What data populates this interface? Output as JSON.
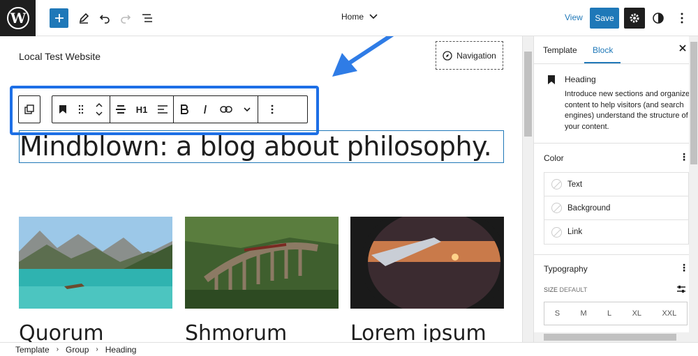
{
  "topbar": {
    "document_title": "Home",
    "view_label": "View",
    "save_label": "Save"
  },
  "canvas": {
    "site_title": "Local Test Website",
    "navigation_label": "Navigation",
    "heading_level": "H1",
    "heading_text": "Mindblown: a blog about philosophy.",
    "posts": [
      {
        "title": "Quorum",
        "image": "mountain-lake-photo"
      },
      {
        "title": "Shmorum",
        "image": "railway-viaduct-photo"
      },
      {
        "title": "Lorem ipsum",
        "image": "airplane-window-sunset-photo"
      }
    ]
  },
  "breadcrumbs": [
    "Template",
    "Group",
    "Heading"
  ],
  "sidebar": {
    "tabs": [
      "Template",
      "Block"
    ],
    "active_tab": "Block",
    "block": {
      "name": "Heading",
      "description": "Introduce new sections and organize content to help visitors (and search engines) understand the structure of your content."
    },
    "color": {
      "title": "Color",
      "items": [
        "Text",
        "Background",
        "Link"
      ]
    },
    "typography": {
      "title": "Typography",
      "size_label": "SIZE",
      "size_value": "DEFAULT",
      "sizes": [
        "S",
        "M",
        "L",
        "XL",
        "XXL"
      ]
    }
  },
  "colors": {
    "accent": "#1f78b8",
    "highlight": "#1d6fe6",
    "dark": "#1e1e1e"
  }
}
